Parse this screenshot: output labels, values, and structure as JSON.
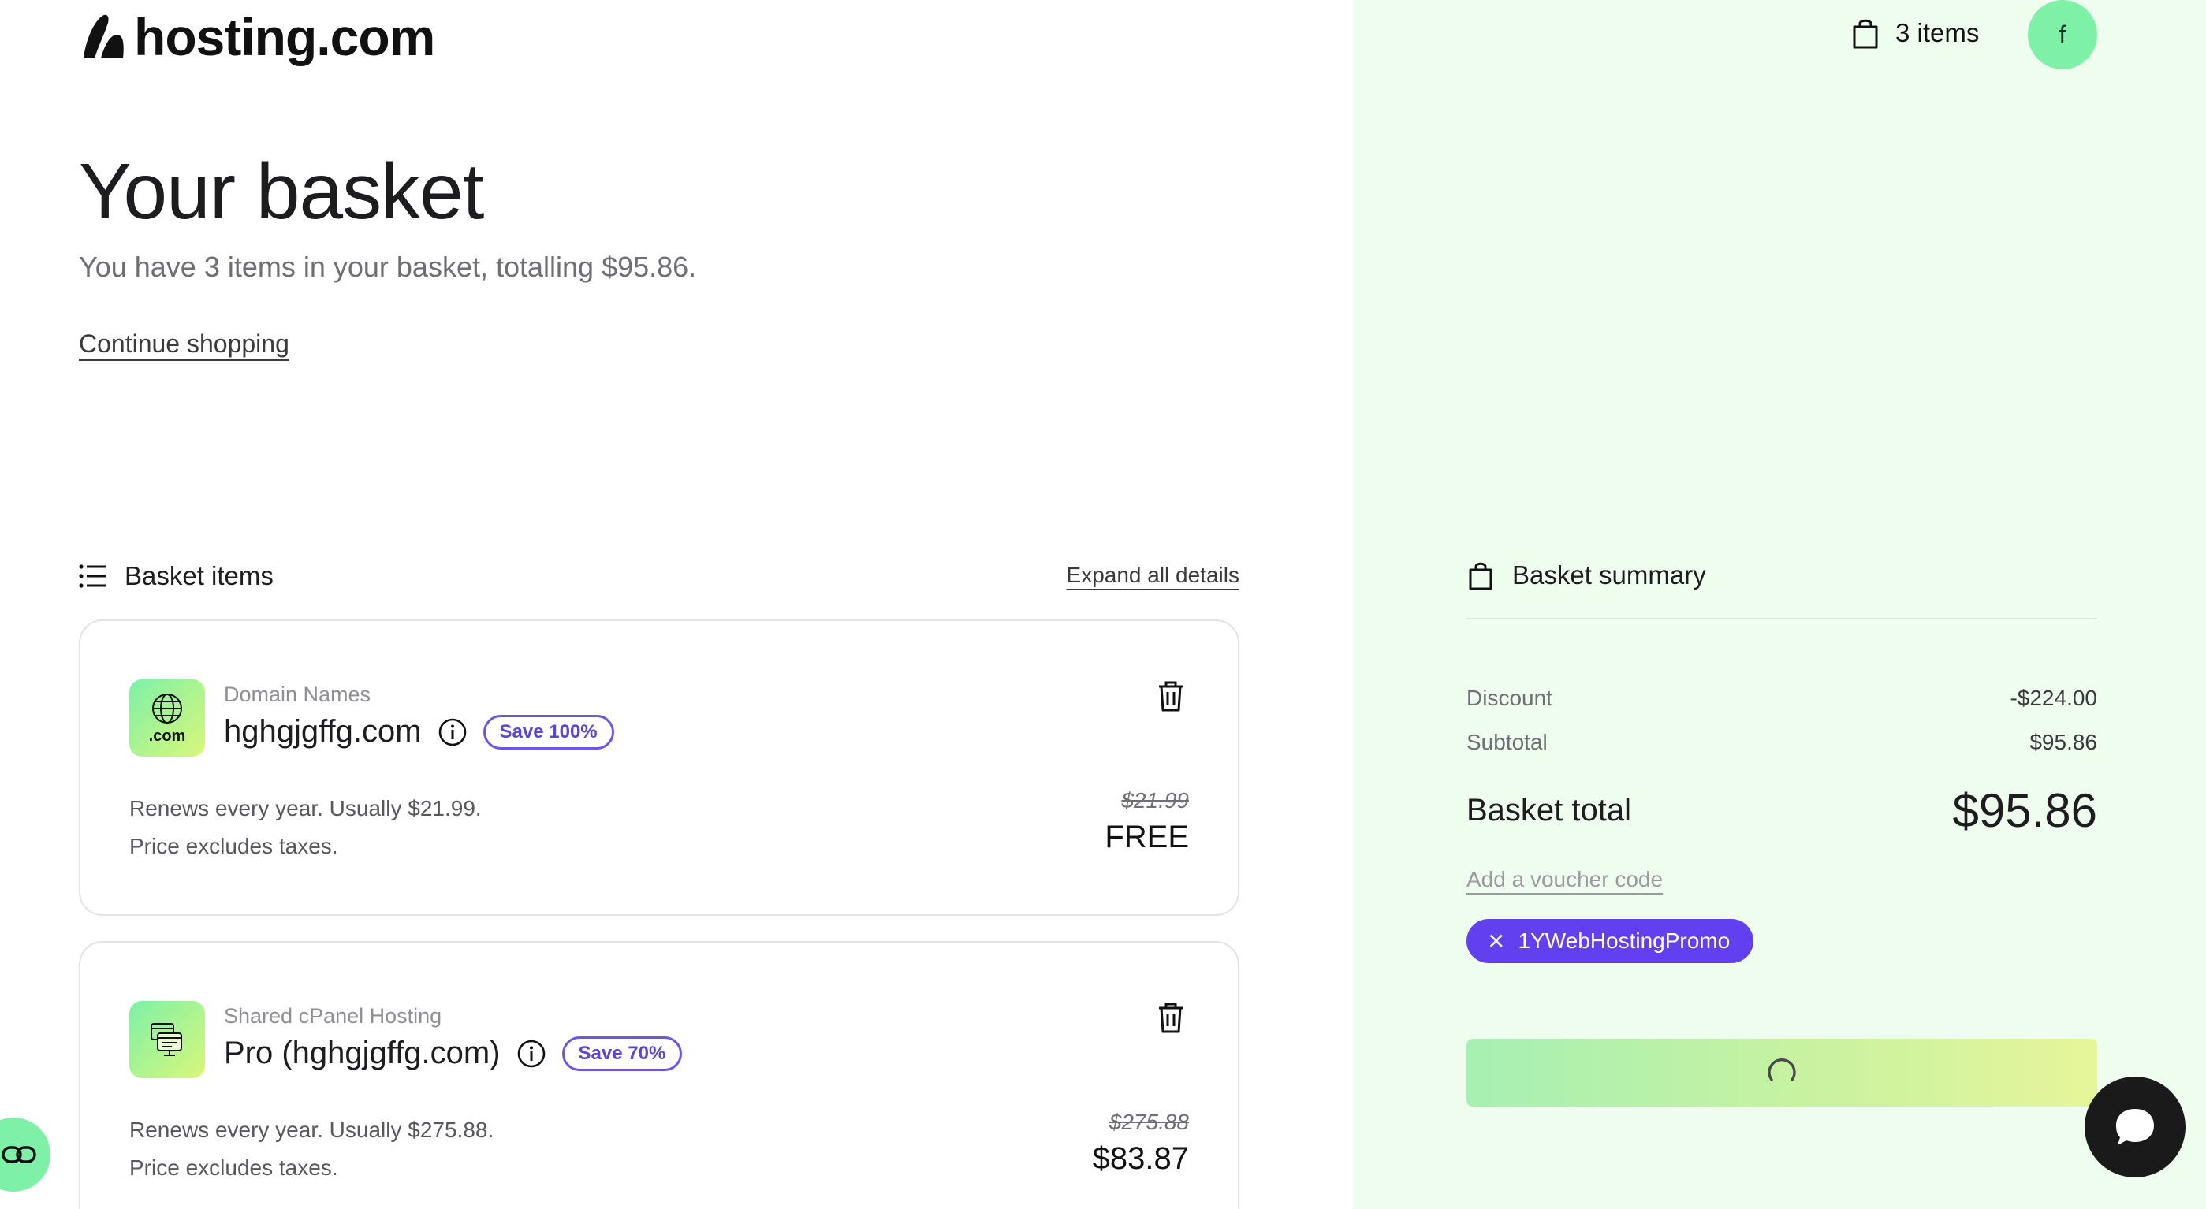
{
  "header": {
    "logo_text": "hosting.com",
    "cart_count_label": "3 items",
    "avatar_initial": "f"
  },
  "intro": {
    "title": "Your basket",
    "subtitle": "You have 3 items in your basket, totalling $95.86.",
    "continue_label": "Continue shopping"
  },
  "items_section": {
    "heading": "Basket items",
    "expand_label": "Expand all details",
    "items": [
      {
        "category": "Domain Names",
        "name": "hghgjgffg.com",
        "icon": "globe-icon",
        "icon_caption": ".com",
        "save_badge": "Save 100%",
        "renews": "Renews every year. Usually $21.99.",
        "tax_note": "Price excludes taxes.",
        "old_price": "$21.99",
        "price": "FREE"
      },
      {
        "category": "Shared cPanel Hosting",
        "name": "Pro (hghgjgffg.com)",
        "icon": "hosting-panel-icon",
        "save_badge": "Save 70%",
        "renews": "Renews every year. Usually $275.88.",
        "tax_note": "Price excludes taxes.",
        "old_price": "$275.88",
        "price": "$83.87"
      }
    ]
  },
  "summary": {
    "heading": "Basket summary",
    "discount_label": "Discount",
    "discount_value": "-$224.00",
    "subtotal_label": "Subtotal",
    "subtotal_value": "$95.86",
    "total_label": "Basket total",
    "total_value": "$95.86",
    "voucher_label": "Add a voucher code",
    "promo_code": "1YWebHostingPromo"
  },
  "colors": {
    "summary_bg": "#effdef",
    "accent_green": "#7ef0a8",
    "promo_purple": "#6240f0",
    "badge_purple": "#6b57e6"
  }
}
